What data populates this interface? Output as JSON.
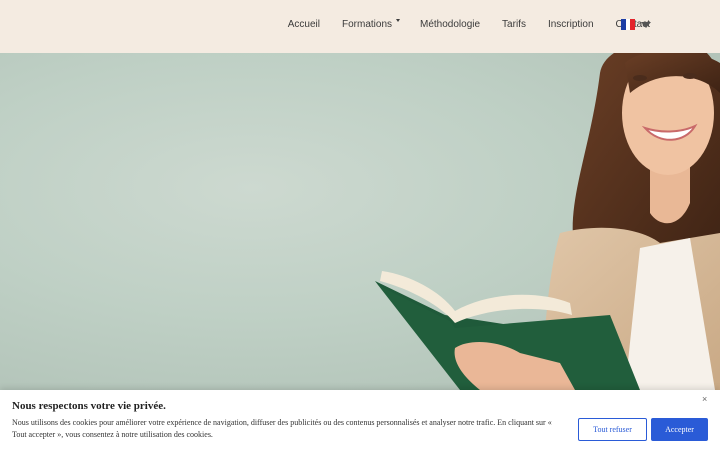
{
  "nav": {
    "items": [
      {
        "label": "Accueil"
      },
      {
        "label": "Formations"
      },
      {
        "label": "Méthodologie"
      },
      {
        "label": "Tarifs"
      },
      {
        "label": "Inscription"
      },
      {
        "label": "Contact"
      }
    ],
    "language_flag": "flag-fr-icon",
    "flag_colors": [
      "#1d3ea5",
      "#ffffff",
      "#e3242b"
    ]
  },
  "cookie_banner": {
    "title": "Nous respectons votre vie privée.",
    "text": "Nous utilisons des cookies pour améliorer votre expérience de navigation, diffuser des publicités ou des contenus personnalisés et analyser notre trafic. En cliquant sur « Tout accepter », vous consentez à notre utilisation des cookies.",
    "close": "×",
    "refuse_label": "Tout refuser",
    "accept_label": "Accepter",
    "accent_color": "#2a5bd7"
  }
}
